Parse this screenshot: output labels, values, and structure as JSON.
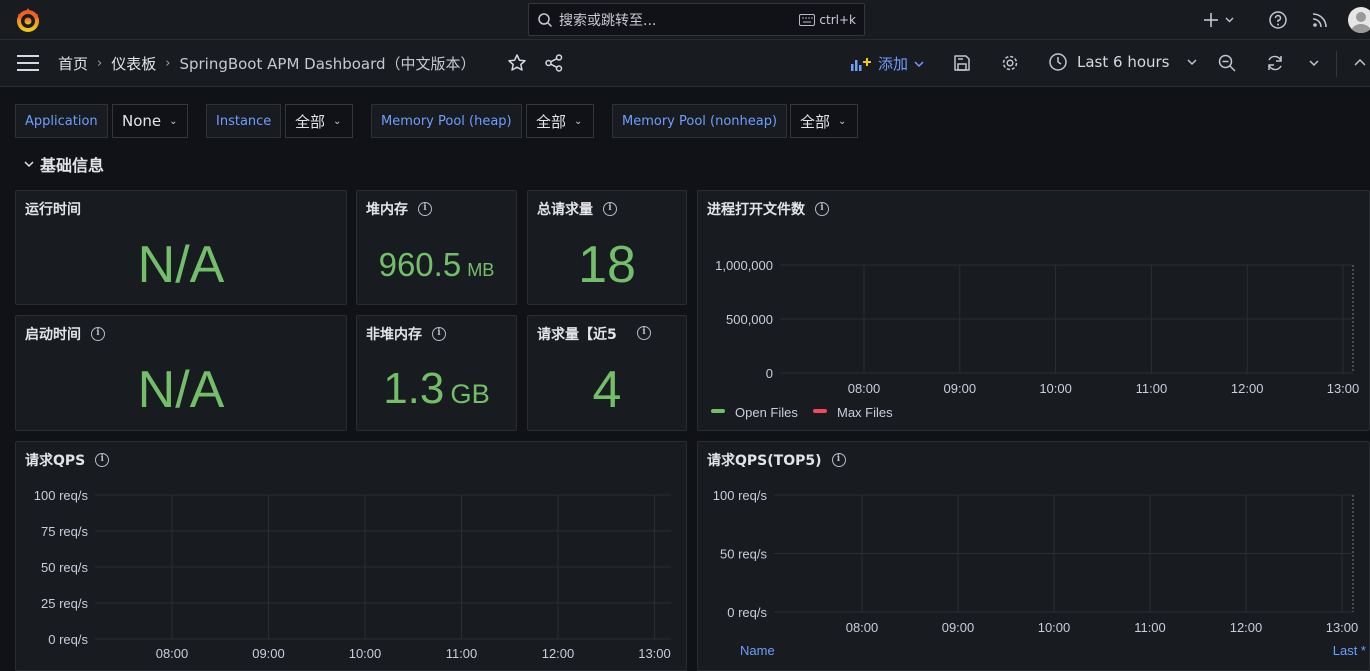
{
  "search": {
    "placeholder": "搜索或跳转至...",
    "shortcut": "ctrl+k"
  },
  "breadcrumb": {
    "home": "首页",
    "dashboards": "仪表板",
    "current": "SpringBoot APM Dashboard（中文版本）"
  },
  "toolbar": {
    "add_label": "添加",
    "time_range": "Last 6 hours"
  },
  "variables": [
    {
      "label": "Application",
      "value": "None"
    },
    {
      "label": "Instance",
      "value": "全部"
    },
    {
      "label": "Memory Pool (heap)",
      "value": "全部"
    },
    {
      "label": "Memory Pool (nonheap)",
      "value": "全部"
    }
  ],
  "row": {
    "title": "基础信息"
  },
  "stats": {
    "uptime": {
      "title": "运行时间",
      "value": "N/A"
    },
    "heap": {
      "title": "堆内存",
      "value": "960.5",
      "unit": "MB"
    },
    "total_requests": {
      "title": "总请求量",
      "value": "18"
    },
    "start_time": {
      "title": "启动时间",
      "value": "N/A"
    },
    "nonheap": {
      "title": "非堆内存",
      "value": "1.3",
      "unit": "GB"
    },
    "recent_requests": {
      "title": "请求量【近5",
      "value": "4"
    }
  },
  "colors": {
    "stat_green": "#73bf69",
    "accent_blue": "#6e9fff",
    "open_files": "#73bf69",
    "max_files": "#f2495c"
  },
  "chart_data": [
    {
      "panel": "open_files",
      "type": "line",
      "title": "进程打开文件数",
      "x_ticks": [
        "08:00",
        "09:00",
        "10:00",
        "11:00",
        "12:00",
        "13:00"
      ],
      "y_ticks": [
        "1,000,000",
        "500,000",
        "0"
      ],
      "ylim": [
        0,
        1000000
      ],
      "legend": [
        "Open Files",
        "Max Files"
      ],
      "series": []
    },
    {
      "panel": "qps",
      "type": "line",
      "title": "请求QPS",
      "x_ticks": [
        "08:00",
        "09:00",
        "10:00",
        "11:00",
        "12:00",
        "13:00"
      ],
      "y_ticks": [
        "100 req/s",
        "75 req/s",
        "50 req/s",
        "25 req/s",
        "0 req/s"
      ],
      "ylim": [
        0,
        100
      ],
      "series": []
    },
    {
      "panel": "qps_top5",
      "type": "line",
      "title": "请求QPS(TOP5)",
      "x_ticks": [
        "08:00",
        "09:00",
        "10:00",
        "11:00",
        "12:00",
        "13:00"
      ],
      "y_ticks": [
        "100 req/s",
        "50 req/s",
        "0 req/s"
      ],
      "ylim": [
        0,
        100
      ],
      "legend_columns": [
        "Name",
        "Last *"
      ],
      "series": []
    }
  ]
}
